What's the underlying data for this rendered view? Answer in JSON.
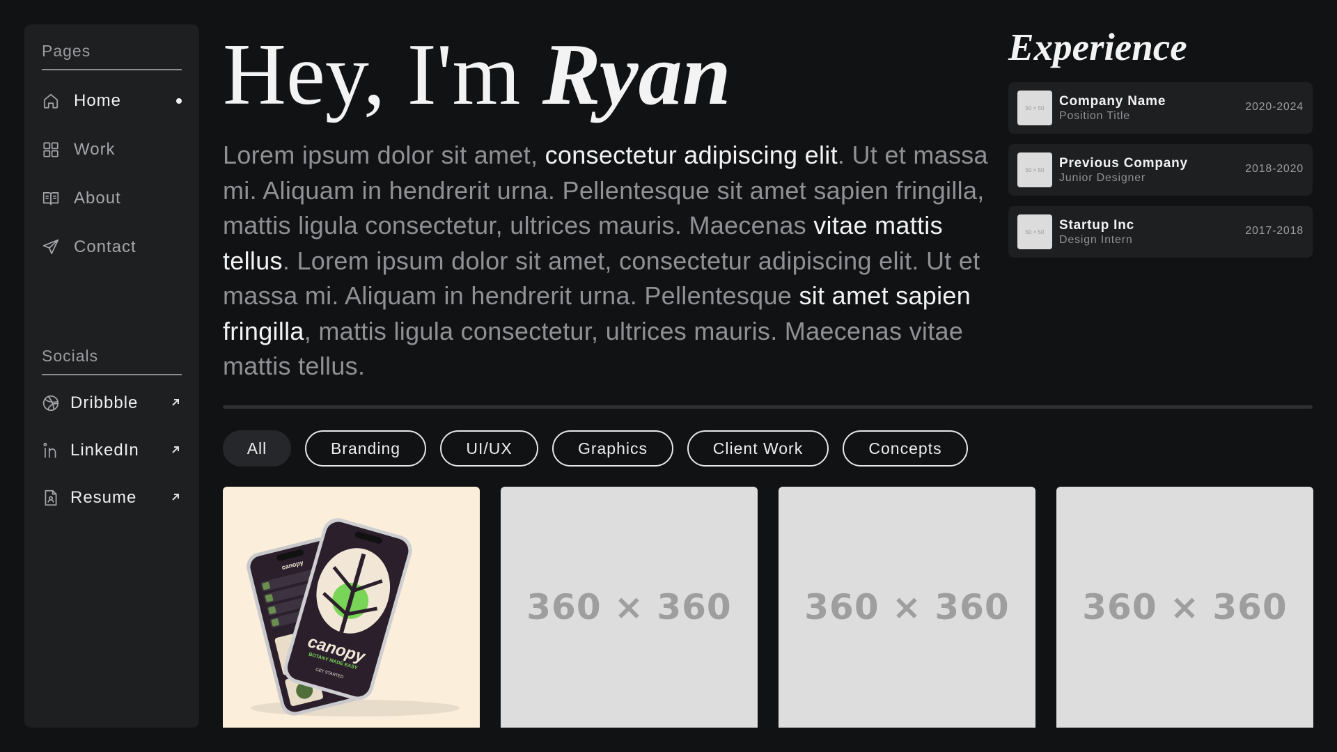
{
  "sidebar": {
    "pages_title": "Pages",
    "pages": [
      {
        "label": "Home",
        "icon": "home-icon",
        "active": true
      },
      {
        "label": "Work",
        "icon": "grid-icon",
        "active": false
      },
      {
        "label": "About",
        "icon": "book-icon",
        "active": false
      },
      {
        "label": "Contact",
        "icon": "send-icon",
        "active": false
      }
    ],
    "socials_title": "Socials",
    "socials": [
      {
        "label": "Dribbble",
        "icon": "dribbble-icon"
      },
      {
        "label": "LinkedIn",
        "icon": "linkedin-icon"
      },
      {
        "label": "Resume",
        "icon": "document-icon"
      }
    ]
  },
  "hero": {
    "greeting": "Hey, I'm ",
    "name": "Ryan",
    "bio": {
      "p1": "Lorem ipsum dolor sit amet, ",
      "h1": "consectetur adipiscing elit",
      "p2": ". Ut et massa mi. Aliquam in hendrerit urna. Pellentesque sit amet sapien fringilla, mattis ligula consectetur, ultrices mauris. Maecenas ",
      "h2": "vitae mattis tellus",
      "p3": ". Lorem ipsum dolor sit amet, consectetur adipiscing elit. Ut et massa mi. Aliquam in hendrerit urna. Pellentesque ",
      "h3": "sit amet sapien fringilla",
      "p4": ", mattis ligula consectetur, ultrices mauris. Maecenas vitae mattis tellus."
    }
  },
  "experience": {
    "title": "Experience",
    "items": [
      {
        "logo": "50 × 50",
        "company": "Company Name",
        "role": "Position Title",
        "years": "2020-2024"
      },
      {
        "logo": "50 × 50",
        "company": "Previous Company",
        "role": "Junior Designer",
        "years": "2018-2020"
      },
      {
        "logo": "50 × 50",
        "company": "Startup Inc",
        "role": "Design Intern",
        "years": "2017-2018"
      }
    ]
  },
  "filters": [
    {
      "label": "All",
      "active": true
    },
    {
      "label": "Branding",
      "active": false
    },
    {
      "label": "UI/UX",
      "active": false
    },
    {
      "label": "Graphics",
      "active": false
    },
    {
      "label": "Client Work",
      "active": false
    },
    {
      "label": "Concepts",
      "active": false
    }
  ],
  "gallery": {
    "featured": {
      "brand": "canopy",
      "tagline": "BOTANY MADE EASY",
      "cta": "GET STARTED"
    },
    "placeholders": [
      "360 × 360",
      "360 × 360",
      "360 × 360"
    ]
  }
}
